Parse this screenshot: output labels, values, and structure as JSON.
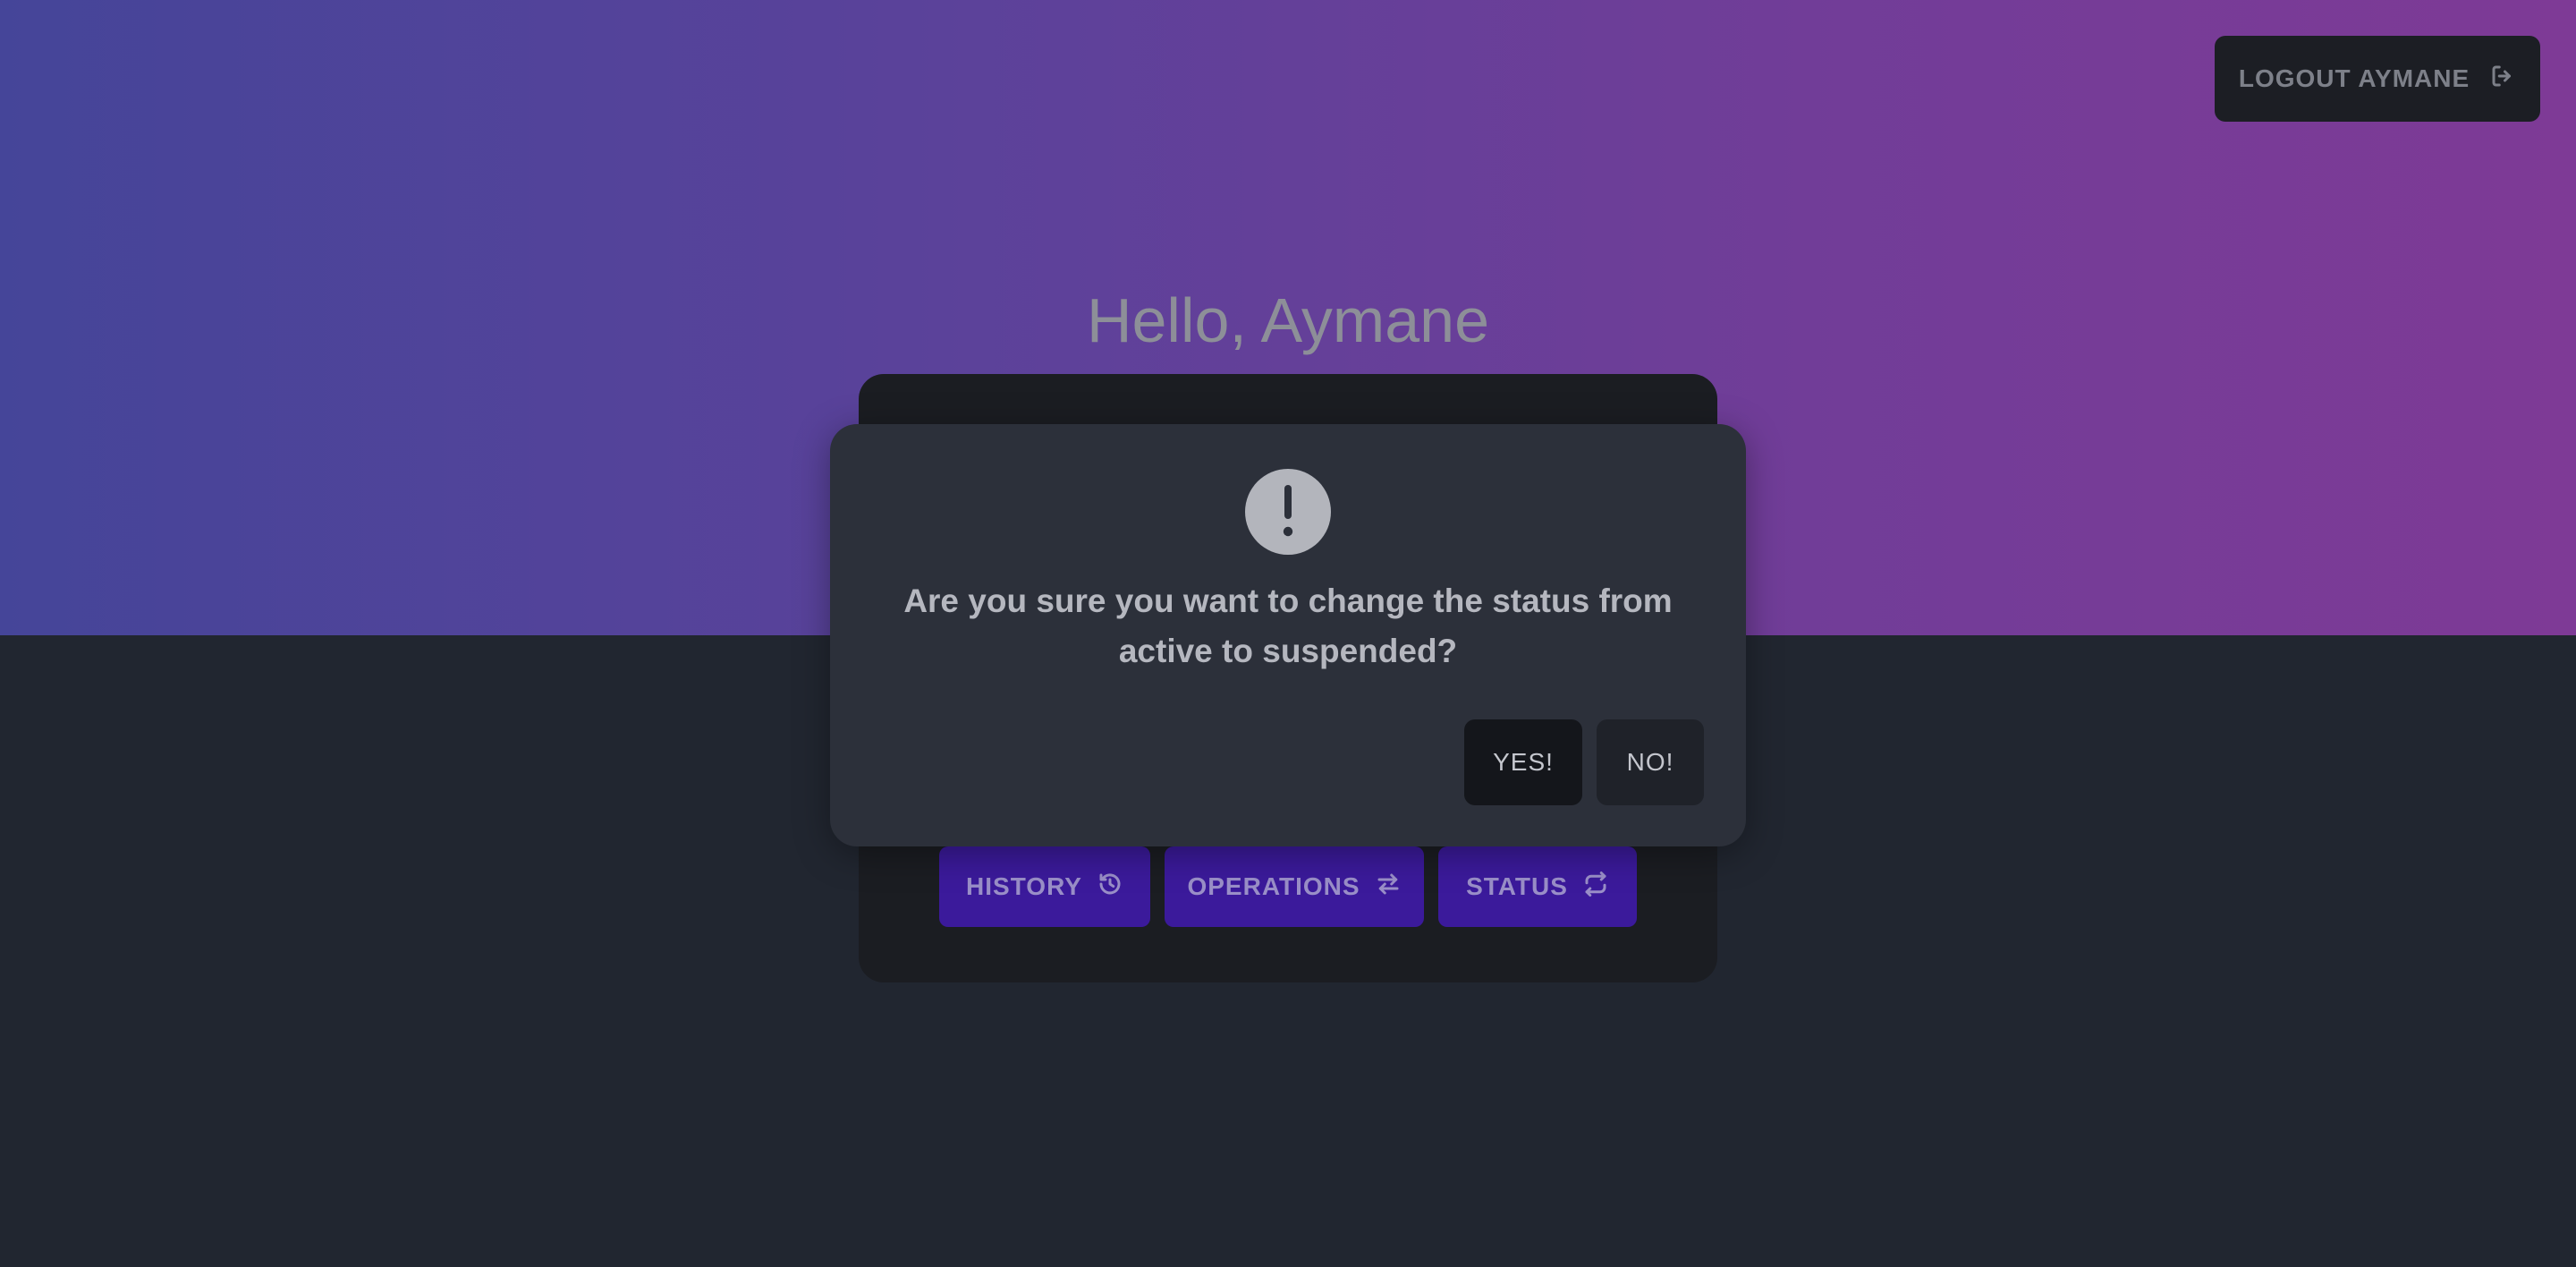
{
  "header": {
    "logout_label": "LOGOUT AYMANE",
    "logout_icon": "logout-icon"
  },
  "greeting": "Hello, Aymane",
  "actions": [
    {
      "label": "HISTORY",
      "icon": "history-icon"
    },
    {
      "label": "OPERATIONS",
      "icon": "transfer-arrows-icon"
    },
    {
      "label": "STATUS",
      "icon": "repeat-icon"
    }
  ],
  "dialog": {
    "icon": "exclamation-icon",
    "message": "Are you sure you want to change the status from active to suspended?",
    "confirm_label": "YES!",
    "cancel_label": "NO!"
  },
  "colors": {
    "gradient_start": "#454599",
    "gradient_end": "#7e3a96",
    "action_button": "#3b1a9b",
    "dialog_bg": "#2c303a"
  }
}
